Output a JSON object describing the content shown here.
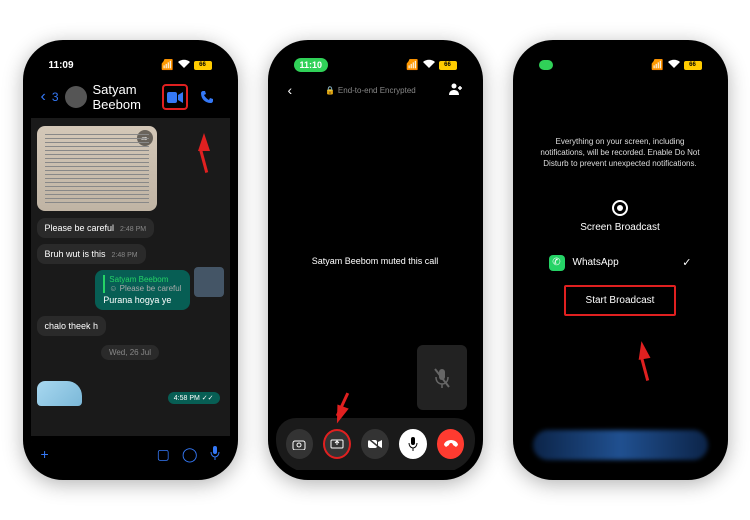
{
  "phone1": {
    "time": "11:09",
    "back_count": "3",
    "contact": "Satyam Beebom",
    "msg1": "Please be careful",
    "msg1_time": "2:48 PM",
    "msg2": "Bruh wut is this",
    "msg2_time": "2:48 PM",
    "reply_name": "Satyam Beebom",
    "reply_text": "☺ Please be careful",
    "msg3": "Purana hogya ye",
    "msg4": "chalo theek h",
    "date": "Wed, 26 Jul",
    "sent_time": "4:58 PM ✓✓"
  },
  "phone2": {
    "time": "11:10",
    "encrypted": "End-to-end Encrypted",
    "muted": "Satyam Beebom muted this call"
  },
  "phone3": {
    "info": "Everything on your screen, including notifications, will be recorded. Enable Do Not Disturb to prevent unexpected notifications.",
    "title": "Screen Broadcast",
    "app": "WhatsApp",
    "button": "Start Broadcast"
  }
}
